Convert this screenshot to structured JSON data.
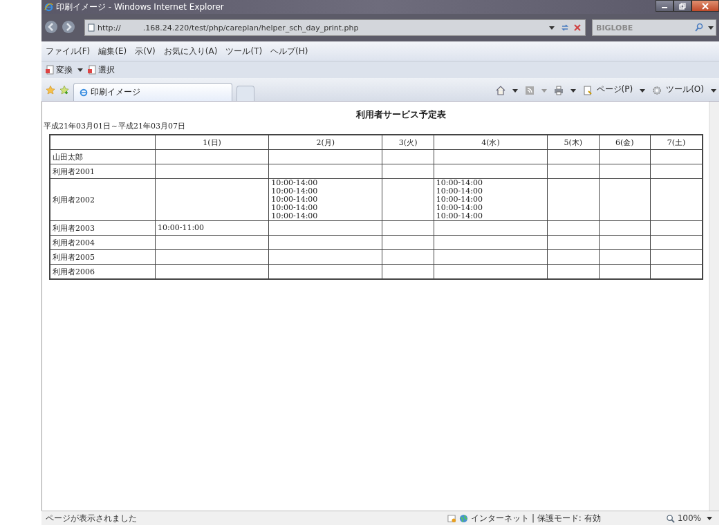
{
  "window": {
    "title": "印刷イメージ - Windows Internet Explorer"
  },
  "address_bar": {
    "url_start": "http://",
    "url_end": ".168.24.220/test/php/careplan/helper_sch_day_print.php"
  },
  "search": {
    "placeholder": "BIGLOBE"
  },
  "menu": [
    "ファイル(F)",
    "編集(E)",
    "示(V)",
    "お気に入り(A)",
    "ツール(T)",
    "ヘルプ(H)"
  ],
  "toolbar": [
    "変換",
    "選択"
  ],
  "tabs": [
    {
      "label": "印刷イメージ",
      "selected": true
    },
    {
      "selected": false
    }
  ],
  "commands": [
    "ページ(P)",
    "ツール(O)"
  ],
  "page": {
    "title": "利用者サービス予定表",
    "date_range": "平成21年03月01日～平成21年03月07日",
    "columns": [
      "1(日)",
      "2(月)",
      "3(火)",
      "4(水)",
      "5(木)",
      "6(金)",
      "7(土)"
    ],
    "rows": [
      {
        "name": "山田太郎",
        "cells": [
          {},
          {},
          {},
          {},
          {},
          {},
          {}
        ]
      },
      {
        "name": "利用者2001",
        "cells": [
          {},
          {},
          {},
          {},
          {},
          {},
          {}
        ]
      },
      {
        "name": "利用者2002",
        "cells": [
          {},
          {
            "times": [
              "10:00-14:00",
              "10:00-14:00",
              "10:00-14:00",
              "10:00-14:00",
              "10:00-14:00"
            ]
          },
          {},
          {
            "times": [
              "10:00-14:00",
              "10:00-14:00",
              "10:00-14:00",
              "10:00-14:00",
              "10:00-14:00"
            ]
          },
          {},
          {},
          {}
        ]
      },
      {
        "name": "利用者2003",
        "cells": [
          {
            "times": [
              "10:00-11:00"
            ]
          },
          {},
          {},
          {},
          {},
          {},
          {}
        ]
      },
      {
        "name": "利用者2004",
        "cells": [
          {},
          {},
          {},
          {},
          {},
          {},
          {}
        ]
      },
      {
        "name": "利用者2005",
        "cells": [
          {},
          {},
          {},
          {},
          {},
          {},
          {}
        ]
      },
      {
        "name": "利用者2006",
        "cells": [
          {},
          {},
          {},
          {},
          {},
          {},
          {}
        ]
      }
    ]
  },
  "status_bar": {
    "message": "ページが表示されました",
    "zone": "インターネット | 保護モード: 有効",
    "zoom": "100%"
  }
}
